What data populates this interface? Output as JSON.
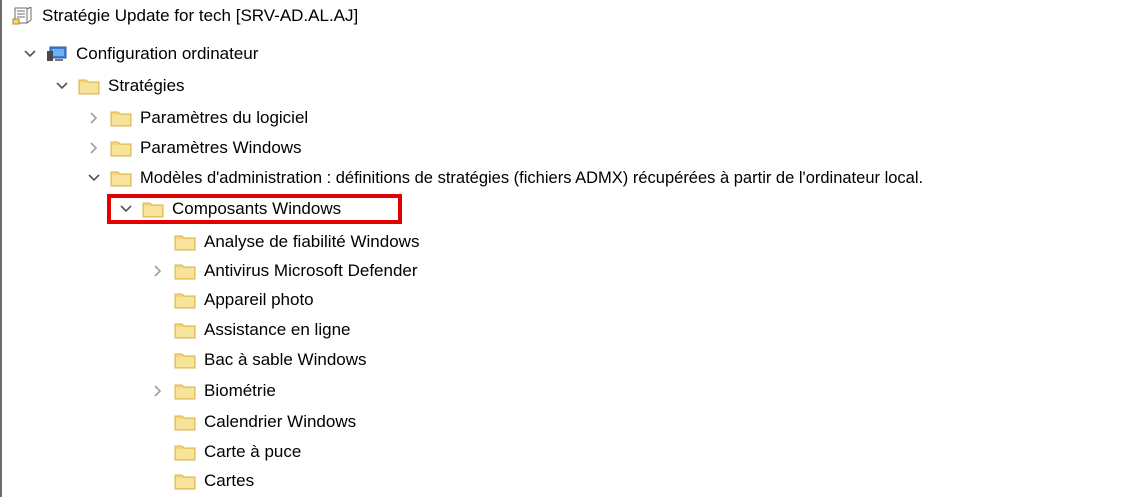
{
  "tree": {
    "root": {
      "label": "Stratégie Update for tech [SRV-AD.AL.AJ]",
      "icon": "policy-document-icon"
    },
    "computer_config": {
      "label": "Configuration ordinateur",
      "icon": "computer-icon",
      "expanded": true
    },
    "strategies": {
      "label": "Stratégies",
      "icon": "folder-icon",
      "expanded": true
    },
    "software_settings": {
      "label": "Paramètres du logiciel",
      "icon": "folder-icon",
      "expanded": false
    },
    "windows_settings": {
      "label": "Paramètres Windows",
      "icon": "folder-icon",
      "expanded": false
    },
    "admin_templates": {
      "label": "Modèles d'administration : définitions de stratégies (fichiers ADMX) récupérées à partir de l'ordinateur local.",
      "icon": "folder-icon",
      "expanded": true
    },
    "windows_components": {
      "label": "Composants Windows",
      "icon": "folder-icon",
      "expanded": true,
      "highlighted": true
    },
    "children": [
      {
        "label": "Analyse de fiabilité Windows",
        "has_children": false
      },
      {
        "label": "Antivirus Microsoft Defender",
        "has_children": true
      },
      {
        "label": "Appareil photo",
        "has_children": false
      },
      {
        "label": "Assistance en ligne",
        "has_children": false
      },
      {
        "label": "Bac à sable Windows",
        "has_children": false
      },
      {
        "label": "Biométrie",
        "has_children": true
      },
      {
        "label": "Calendrier Windows",
        "has_children": false
      },
      {
        "label": "Carte à puce",
        "has_children": false
      },
      {
        "label": "Cartes",
        "has_children": false
      }
    ]
  },
  "colors": {
    "folder": "#f3d77a",
    "folder_dark": "#d9b54a",
    "highlight": "#e30000",
    "chevron": "#555555",
    "chevron_collapsed": "#a0a0a0"
  }
}
